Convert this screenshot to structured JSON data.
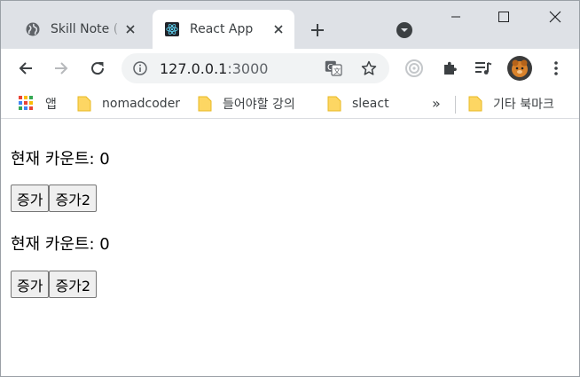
{
  "tabs": [
    {
      "title": "Skill Note (",
      "active": false,
      "favicon": "globe-icon"
    },
    {
      "title": "React App",
      "active": true,
      "favicon": "react-logo-icon"
    }
  ],
  "toolbar": {
    "url_host": "127.0.0.1",
    "url_port": ":3000"
  },
  "bookmarks": {
    "apps_label": "앱",
    "items": [
      "nomadcoder",
      "들어야할 강의",
      "sleact"
    ],
    "more_label": "»",
    "other_label": "기타 북마크"
  },
  "page": {
    "counters": [
      {
        "text": "현재 카운트: 0",
        "buttons": [
          "증가",
          "증가2"
        ]
      },
      {
        "text": "현재 카운트: 0",
        "buttons": [
          "증가",
          "증가2"
        ]
      }
    ]
  },
  "colors": {
    "tabstrip_bg": "#dee1e6",
    "omnibox_bg": "#f1f3f4",
    "icon_gray": "#5f6368",
    "folder_yellow": "#fdd663"
  }
}
